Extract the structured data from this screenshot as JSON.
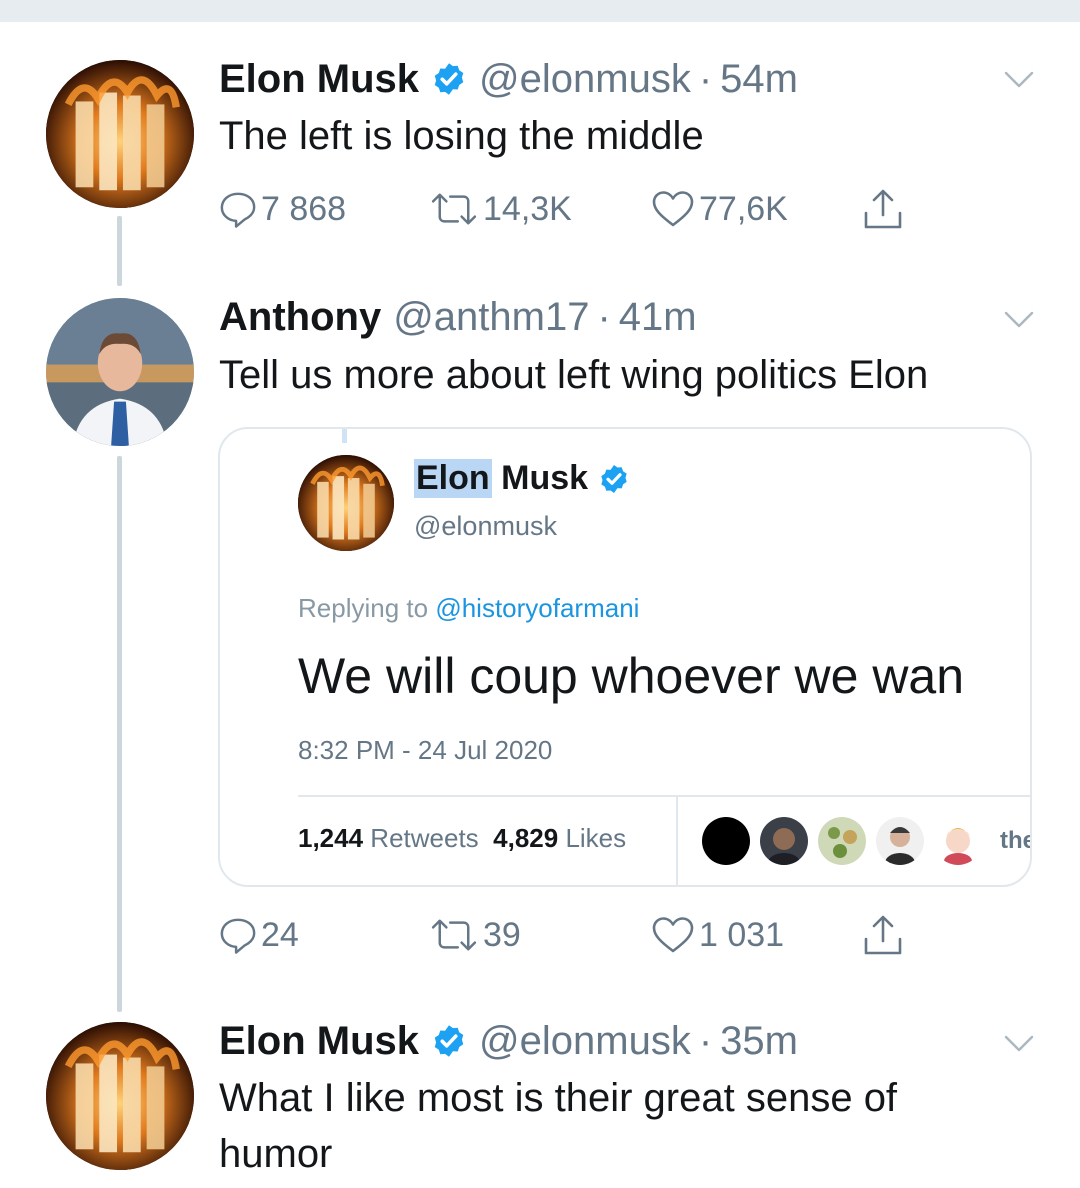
{
  "colors": {
    "name": "#14171a",
    "meta": "#657786",
    "link": "#1b95e0",
    "verified": "#1da1f2",
    "thread_line": "#ccd6dd"
  },
  "tweets": [
    {
      "name": "Elon Musk",
      "verified": true,
      "handle": "@elonmusk",
      "separator": "·",
      "time": "54m",
      "text": "The left is losing the middle",
      "replies": "7 868",
      "retweets": "14,3K",
      "likes": "77,6K"
    },
    {
      "name": "Anthony",
      "verified": false,
      "handle": "@anthm17",
      "separator": "·",
      "time": "41m",
      "text": "Tell us more about left wing politics Elon",
      "replies": "24",
      "retweets": "39",
      "likes": "1 031",
      "quoted": {
        "name_highlight": "Elon",
        "name_rest": " Musk",
        "handle": "@elonmusk",
        "replying_prefix": "Replying to ",
        "replying_to": "@historyofarmani",
        "text": "We will coup whoever we wan",
        "date": "8:32 PM - 24 Jul 2020",
        "retweets_count": "1,244",
        "retweets_label": " Retweets",
        "likes_count": "4,829",
        "likes_label": " Likes",
        "more_likers": "the"
      }
    },
    {
      "name": "Elon Musk",
      "verified": true,
      "handle": "@elonmusk",
      "separator": "·",
      "time": "35m",
      "line1": "What I like most is their great sense of",
      "line2": "humor"
    }
  ]
}
